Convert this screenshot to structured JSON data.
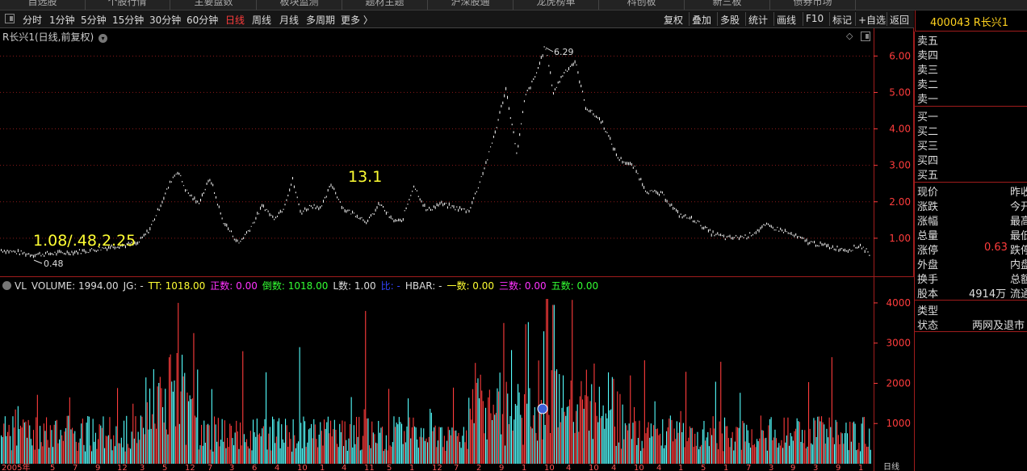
{
  "top_nav": {
    "tabs": [
      "自选股",
      "个股行情",
      "主要盘数",
      "板块监测",
      "题材主题",
      "沪深股通",
      "龙虎榜单",
      "科创板",
      "新三板",
      "债券市场"
    ]
  },
  "toolbar": {
    "timeframes": [
      "分时",
      "1分钟",
      "5分钟",
      "15分钟",
      "30分钟",
      "60分钟",
      "日线",
      "周线",
      "月线",
      "多周期",
      "更多 〉"
    ],
    "active_timeframe": "日线",
    "buttons": [
      "复权",
      "叠加",
      "多股",
      "统计",
      "画线",
      "F10",
      "标记",
      "+自选",
      "返回"
    ]
  },
  "stock": {
    "code_name": "400043 R长兴1"
  },
  "chart": {
    "title": "R长兴1(日线,前复权)",
    "annotations": {
      "left_text": "1.08/.48,2.25",
      "mid_text": "13.1",
      "high_label": "6.29",
      "low_label": "0.48"
    },
    "colors": {
      "up": "#ff3c3c",
      "down": "#54ffff",
      "price_line": "#ffffff",
      "grid": "#8b1a1a",
      "annotation": "#ffff33"
    }
  },
  "volume": {
    "legend": [
      {
        "text": "VL",
        "color": "#dddddd"
      },
      {
        "text": "VOLUME: 1994.00",
        "color": "#dddddd"
      },
      {
        "text": "JG: -",
        "color": "#dddddd"
      },
      {
        "text": "TT: 1018.00",
        "color": "#ffff33"
      },
      {
        "text": "正数: 0.00",
        "color": "#ff33ff"
      },
      {
        "text": "倒数: 1018.00",
        "color": "#33ff33"
      },
      {
        "text": "L数: 1.00",
        "color": "#dddddd"
      },
      {
        "text": "比: -",
        "color": "#3344ff"
      },
      {
        "text": "HBAR: -",
        "color": "#dddddd"
      },
      {
        "text": "一数: 0.00",
        "color": "#ffff33"
      },
      {
        "text": "三数: 0.00",
        "color": "#ff33ff"
      },
      {
        "text": "五数: 0.00",
        "color": "#33ff33"
      }
    ]
  },
  "quote_panel": {
    "sell": [
      "卖五",
      "卖四",
      "卖三",
      "卖二",
      "卖一"
    ],
    "buy": [
      "买一",
      "买二",
      "买三",
      "买四",
      "买五"
    ],
    "stats_left": [
      "现价",
      "涨跌",
      "涨幅",
      "总量",
      "涨停",
      "外盘",
      "换手",
      "股本"
    ],
    "stats_right": [
      "昨收",
      "今开",
      "最高",
      "最低",
      "跌停",
      "内盘",
      "总额",
      "流通"
    ],
    "limit_up": "0.63",
    "share_capital": "4914万",
    "type_label": "类型",
    "status_label": "状态",
    "status_value": "两网及退市"
  },
  "date_axis": {
    "year_label": "2005年",
    "ticks": [
      "5",
      "7",
      "9",
      "12",
      "3",
      "5",
      "12",
      "7",
      "3",
      "6",
      "4",
      "10",
      "1",
      "4",
      "11",
      "5",
      "1",
      "12",
      "7",
      "2",
      "9",
      "1",
      "10",
      "4",
      "10",
      "4",
      "10",
      "4",
      "1",
      "5",
      "1",
      "7",
      "3",
      "9",
      "3",
      "9",
      "1"
    ],
    "end_label": "日线"
  },
  "chart_data": {
    "type": "line",
    "title": "R长兴1(日线,前复权)",
    "ylim": [
      0.0,
      6.65
    ],
    "yticks": [
      1.0,
      2.0,
      3.0,
      4.0,
      5.0,
      6.0
    ],
    "ytick_labels": [
      "1.00",
      "2.00",
      "3.00",
      "4.00",
      "5.00",
      "6.00"
    ],
    "price_anchors": [
      [
        0,
        0.68
      ],
      [
        40,
        0.55
      ],
      [
        80,
        0.6
      ],
      [
        110,
        0.66
      ],
      [
        140,
        0.78
      ],
      [
        170,
        0.85
      ],
      [
        185,
        1.25
      ],
      [
        200,
        2.0
      ],
      [
        213,
        2.65
      ],
      [
        220,
        2.85
      ],
      [
        230,
        2.3
      ],
      [
        245,
        1.95
      ],
      [
        260,
        2.65
      ],
      [
        275,
        1.5
      ],
      [
        295,
        0.85
      ],
      [
        310,
        1.3
      ],
      [
        325,
        1.9
      ],
      [
        338,
        1.55
      ],
      [
        350,
        1.8
      ],
      [
        362,
        2.6
      ],
      [
        372,
        1.7
      ],
      [
        385,
        1.9
      ],
      [
        398,
        1.85
      ],
      [
        410,
        2.5
      ],
      [
        425,
        1.8
      ],
      [
        440,
        1.65
      ],
      [
        455,
        1.45
      ],
      [
        470,
        1.95
      ],
      [
        485,
        1.5
      ],
      [
        497,
        1.45
      ],
      [
        512,
        2.45
      ],
      [
        528,
        1.75
      ],
      [
        545,
        1.95
      ],
      [
        560,
        1.85
      ],
      [
        580,
        1.75
      ],
      [
        590,
        2.3
      ],
      [
        605,
        3.3
      ],
      [
        615,
        4.1
      ],
      [
        626,
        5.1
      ],
      [
        640,
        3.3
      ],
      [
        650,
        4.9
      ],
      [
        662,
        5.4
      ],
      [
        675,
        6.29
      ],
      [
        685,
        5.0
      ],
      [
        698,
        5.55
      ],
      [
        712,
        5.85
      ],
      [
        725,
        4.6
      ],
      [
        745,
        4.2
      ],
      [
        765,
        3.2
      ],
      [
        785,
        2.95
      ],
      [
        800,
        2.3
      ],
      [
        820,
        2.2
      ],
      [
        840,
        1.65
      ],
      [
        860,
        1.5
      ],
      [
        880,
        1.15
      ],
      [
        900,
        1.0
      ],
      [
        925,
        1.05
      ],
      [
        948,
        1.35
      ],
      [
        970,
        1.2
      ],
      [
        1000,
        0.9
      ],
      [
        1030,
        0.75
      ],
      [
        1050,
        0.68
      ],
      [
        1065,
        0.8
      ],
      [
        1078,
        0.55
      ]
    ],
    "volume_ylim": [
      0,
      4300
    ],
    "volume_yticks": [
      1000,
      2000,
      3000,
      4000
    ],
    "volume_ytick_labels": [
      "1000",
      "2000",
      "3000",
      "4000"
    ],
    "volume_peaks": [
      [
        220,
        4000
      ],
      [
        240,
        3250
      ],
      [
        300,
        2800
      ],
      [
        370,
        2900
      ],
      [
        452,
        3800
      ],
      [
        623,
        3500
      ],
      [
        677,
        4100
      ],
      [
        685,
        3950
      ],
      [
        1030,
        2650
      ]
    ]
  }
}
